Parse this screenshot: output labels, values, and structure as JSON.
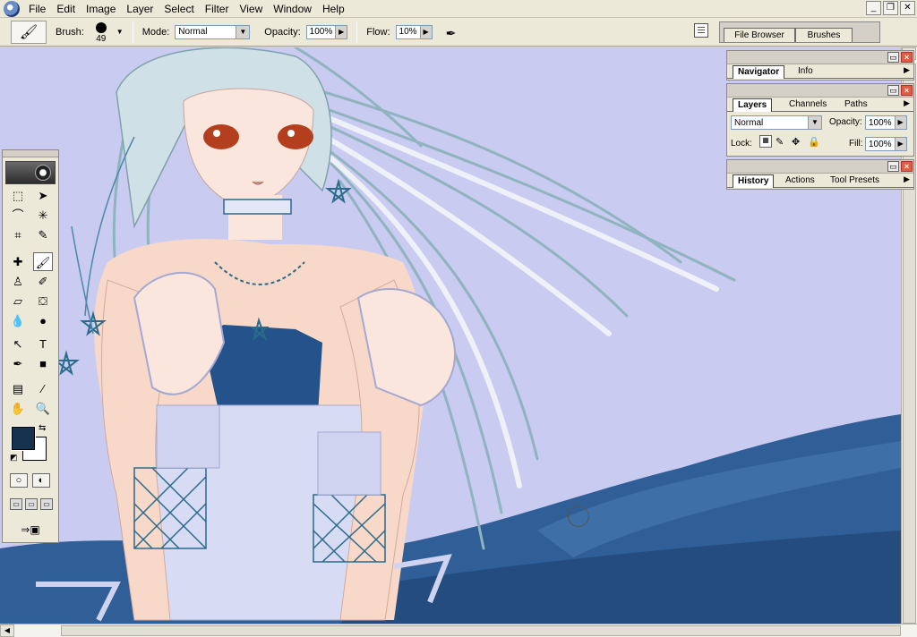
{
  "menubar": {
    "items": [
      "File",
      "Edit",
      "Image",
      "Layer",
      "Select",
      "Filter",
      "View",
      "Window",
      "Help"
    ],
    "window_controls": [
      "_",
      "❐",
      "✕"
    ]
  },
  "options": {
    "brush_label": "Brush:",
    "brush_size": "49",
    "mode_label": "Mode:",
    "mode_value": "Normal",
    "opacity_label": "Opacity:",
    "opacity_value": "100%",
    "flow_label": "Flow:",
    "flow_value": "10%"
  },
  "well": {
    "tabs": [
      "File Browser",
      "Brushes"
    ]
  },
  "palettes": {
    "navigator": {
      "tabs": [
        "Navigator",
        "Info"
      ]
    },
    "layers": {
      "tabs": [
        "Layers",
        "Channels",
        "Paths"
      ],
      "blend_mode": "Normal",
      "opacity_label": "Opacity:",
      "opacity_value": "100%",
      "lock_label": "Lock:",
      "fill_label": "Fill:",
      "fill_value": "100%"
    },
    "history": {
      "tabs": [
        "History",
        "Actions",
        "Tool Presets"
      ]
    }
  },
  "colors": {
    "foreground": "#17324e",
    "background": "#ffffff",
    "canvas_bg": "#c9cbf0",
    "fabric_blue": "#2f5f96"
  },
  "toolbox": {
    "tools": [
      "marquee-icon",
      "move-icon",
      "lasso-icon",
      "magic-wand-icon",
      "crop-icon",
      "slice-icon",
      "healing-brush-icon",
      "brush-icon",
      "clone-stamp-icon",
      "history-brush-icon",
      "eraser-icon",
      "paint-bucket-icon",
      "blur-icon",
      "dodge-icon",
      "path-selection-icon",
      "type-icon",
      "pen-icon",
      "shape-icon",
      "notes-icon",
      "eyedropper-icon",
      "hand-icon",
      "zoom-icon"
    ],
    "active_tool": "brush-icon"
  }
}
